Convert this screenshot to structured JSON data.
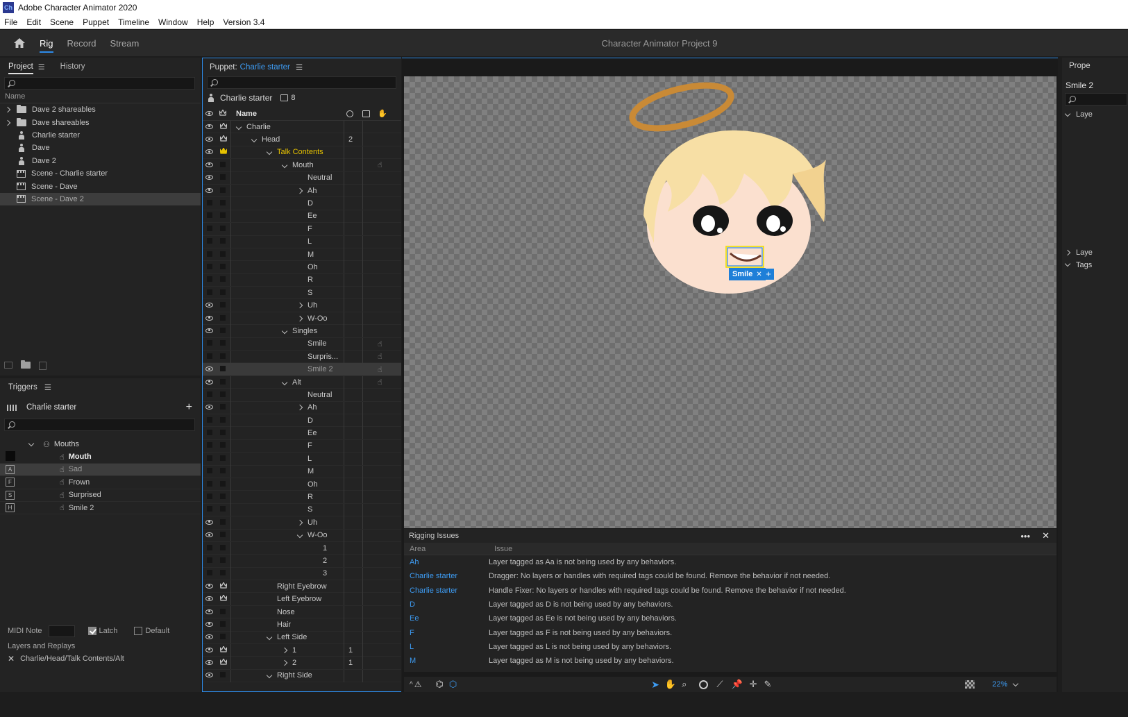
{
  "window": {
    "title": "Adobe Character Animator 2020",
    "icon_label": "Ch"
  },
  "menu": [
    "File",
    "Edit",
    "Scene",
    "Puppet",
    "Timeline",
    "Window",
    "Help",
    "Version 3.4"
  ],
  "workspace": {
    "tabs": [
      "Rig",
      "Record",
      "Stream"
    ],
    "active": "Rig",
    "project_title": "Character Animator Project 9"
  },
  "project_panel": {
    "tabs": [
      "Project",
      "History"
    ],
    "column_header": "Name",
    "items": [
      {
        "label": "Dave 2 shareables",
        "type": "folder",
        "expandable": true
      },
      {
        "label": "Dave shareables",
        "type": "folder",
        "expandable": true
      },
      {
        "label": "Charlie starter",
        "type": "puppet"
      },
      {
        "label": "Dave",
        "type": "puppet"
      },
      {
        "label": "Dave 2",
        "type": "puppet"
      },
      {
        "label": "Scene - Charlie starter",
        "type": "scene"
      },
      {
        "label": "Scene - Dave",
        "type": "scene"
      },
      {
        "label": "Scene - Dave 2",
        "type": "scene",
        "selected": true
      }
    ]
  },
  "triggers_panel": {
    "title": "Triggers",
    "puppet": "Charlie starter",
    "group": "Mouths",
    "items": [
      {
        "key": "",
        "label": "Mouth",
        "bold": true
      },
      {
        "key": "A",
        "label": "Sad",
        "selected": true
      },
      {
        "key": "F",
        "label": "Frown"
      },
      {
        "key": "S",
        "label": "Surprised"
      },
      {
        "key": "H",
        "label": "Smile 2"
      }
    ],
    "midi_label": "MIDI Note",
    "latch_label": "Latch",
    "latch_checked": true,
    "default_label": "Default",
    "default_checked": false,
    "layers_label": "Layers and Replays",
    "layer_path": "Charlie/Head/Talk Contents/Alt"
  },
  "puppet_panel": {
    "prefix": "Puppet:",
    "name": "Charlie starter",
    "header_name": "Charlie starter",
    "header_count": "8",
    "column_name": "Name",
    "rows": [
      {
        "label": "Charlie",
        "indent": 0,
        "exp": "d",
        "eye": true,
        "crown": true
      },
      {
        "label": "Head",
        "indent": 1,
        "exp": "d",
        "eye": true,
        "crown": true,
        "count": "2"
      },
      {
        "label": "Talk Contents",
        "indent": 2,
        "exp": "d",
        "eye": true,
        "crown": "gold",
        "yellow": true
      },
      {
        "label": "Mouth",
        "indent": 3,
        "exp": "d",
        "eye": true,
        "hand": true
      },
      {
        "label": "Neutral",
        "indent": 4,
        "eye": true
      },
      {
        "label": "Ah",
        "indent": 4,
        "exp": "r",
        "eye": true
      },
      {
        "label": "D",
        "indent": 4
      },
      {
        "label": "Ee",
        "indent": 4
      },
      {
        "label": "F",
        "indent": 4
      },
      {
        "label": "L",
        "indent": 4
      },
      {
        "label": "M",
        "indent": 4
      },
      {
        "label": "Oh",
        "indent": 4
      },
      {
        "label": "R",
        "indent": 4
      },
      {
        "label": "S",
        "indent": 4
      },
      {
        "label": "Uh",
        "indent": 4,
        "exp": "r",
        "eye": true
      },
      {
        "label": "W-Oo",
        "indent": 4,
        "exp": "r",
        "eye": true
      },
      {
        "label": "Singles",
        "indent": 3,
        "exp": "d",
        "eye": true
      },
      {
        "label": "Smile",
        "indent": 4,
        "hand": true
      },
      {
        "label": "Surpris...",
        "indent": 4,
        "hand": true
      },
      {
        "label": "Smile 2",
        "indent": 4,
        "hand": true,
        "eye": true,
        "selected": true
      },
      {
        "label": "Alt",
        "indent": 3,
        "exp": "d",
        "eye": true,
        "hand": true
      },
      {
        "label": "Neutral",
        "indent": 4
      },
      {
        "label": "Ah",
        "indent": 4,
        "exp": "r",
        "eye": true
      },
      {
        "label": "D",
        "indent": 4
      },
      {
        "label": "Ee",
        "indent": 4
      },
      {
        "label": "F",
        "indent": 4
      },
      {
        "label": "L",
        "indent": 4
      },
      {
        "label": "M",
        "indent": 4
      },
      {
        "label": "Oh",
        "indent": 4
      },
      {
        "label": "R",
        "indent": 4
      },
      {
        "label": "S",
        "indent": 4
      },
      {
        "label": "Uh",
        "indent": 4,
        "exp": "r",
        "eye": true
      },
      {
        "label": "W-Oo",
        "indent": 4,
        "exp": "d",
        "eye": true
      },
      {
        "label": "1",
        "indent": 5
      },
      {
        "label": "2",
        "indent": 5
      },
      {
        "label": "3",
        "indent": 5
      },
      {
        "label": "Right Eyebrow",
        "indent": 2,
        "eye": true,
        "crown": true
      },
      {
        "label": "Left Eyebrow",
        "indent": 2,
        "eye": true,
        "crown": true
      },
      {
        "label": "Nose",
        "indent": 2,
        "eye": true
      },
      {
        "label": "Hair",
        "indent": 2,
        "eye": true
      },
      {
        "label": "Left Side",
        "indent": 2,
        "exp": "d",
        "eye": true
      },
      {
        "label": "1",
        "indent": 3,
        "exp": "r",
        "eye": true,
        "crown": true,
        "count": "1"
      },
      {
        "label": "2",
        "indent": 3,
        "exp": "r",
        "eye": true,
        "crown": true,
        "count": "1"
      },
      {
        "label": "Right Side",
        "indent": 2,
        "exp": "d",
        "eye": true
      }
    ]
  },
  "canvas": {
    "tag_label": "Smile",
    "zoom": "22%"
  },
  "rigging_issues": {
    "title": "Rigging Issues",
    "col_area": "Area",
    "col_issue": "Issue",
    "rows": [
      {
        "area": "Ah",
        "issue": "Layer tagged as Aa is not being used by any behaviors."
      },
      {
        "area": "Charlie starter",
        "issue": "Dragger: No layers or handles with required tags could be found. Remove the behavior if not needed."
      },
      {
        "area": "Charlie starter",
        "issue": "Handle Fixer: No layers or handles with required tags could be found. Remove the behavior if not needed."
      },
      {
        "area": "D",
        "issue": "Layer tagged as D is not being used by any behaviors."
      },
      {
        "area": "Ee",
        "issue": "Layer tagged as Ee is not being used by any behaviors."
      },
      {
        "area": "F",
        "issue": "Layer tagged as F is not being used by any behaviors."
      },
      {
        "area": "L",
        "issue": "Layer tagged as L is not being used by any behaviors."
      },
      {
        "area": "M",
        "issue": "Layer tagged as M is not being used by any behaviors."
      }
    ]
  },
  "properties_panel": {
    "title": "Prope",
    "item": "Smile 2",
    "sections": [
      "Laye",
      "Laye",
      "Tags"
    ]
  },
  "colors": {
    "accent": "#2d8ceb",
    "link": "#3d9bf2",
    "yellow_label": "#e6c200",
    "tag_bg": "#1e7fd8"
  }
}
